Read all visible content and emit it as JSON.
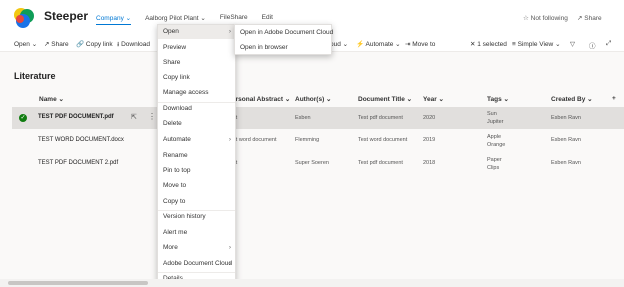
{
  "header": {
    "site_title": "Steeper",
    "nav": [
      "Company",
      "Aalborg Pilot Plant",
      "FileShare",
      "Edit"
    ],
    "not_following": "Not following",
    "share": "Share"
  },
  "commandbar": {
    "open": "Open",
    "share": "Share",
    "copy_link": "Copy link",
    "download": "Download",
    "cloud_partial": "oud",
    "automate": "Automate",
    "move_to": "Move to",
    "selected": "1 selected",
    "view": "Simple View"
  },
  "heading": "Literature",
  "columns": {
    "name": "Name",
    "abstract": "ersonal Abstract",
    "authors": "Author(s)",
    "doc_title": "Document Title",
    "year": "Year",
    "tags": "Tags",
    "created_by": "Created By"
  },
  "rows": [
    {
      "name": "TEST PDF DOCUMENT.pdf",
      "abstract": "est",
      "author": "Esben",
      "title": "Test pdf document",
      "year": "2020",
      "tag1": "Sun",
      "tag2": "Jupiter",
      "created": "Esben Ravn"
    },
    {
      "name": "TEST WORD DOCUMENT.docx",
      "abstract": "est word document",
      "author": "Flemming",
      "title": "Test word document",
      "year": "2019",
      "tag1": "Apple",
      "tag2": "Orange",
      "created": "Esben Ravn"
    },
    {
      "name": "TEST PDF DOCUMENT 2.pdf",
      "abstract": "est",
      "author": "Super Soeren",
      "title": "Test pdf document",
      "year": "2018",
      "tag1": "Paper",
      "tag2": "Clips",
      "created": "Esben Ravn"
    }
  ],
  "context_menu": [
    "Open",
    "Preview",
    "Share",
    "Copy link",
    "Manage access",
    "Download",
    "Delete",
    "Automate",
    "Rename",
    "Pin to top",
    "Move to",
    "Copy to",
    "Version history",
    "Alert me",
    "More",
    "Adobe Document Cloud",
    "Details"
  ],
  "submenu": [
    "Open in Adobe Document Cloud",
    "Open in browser"
  ],
  "colors": {
    "accent": "#0078d4",
    "selected_row": "#e1dfdd",
    "check": "#107c10"
  }
}
